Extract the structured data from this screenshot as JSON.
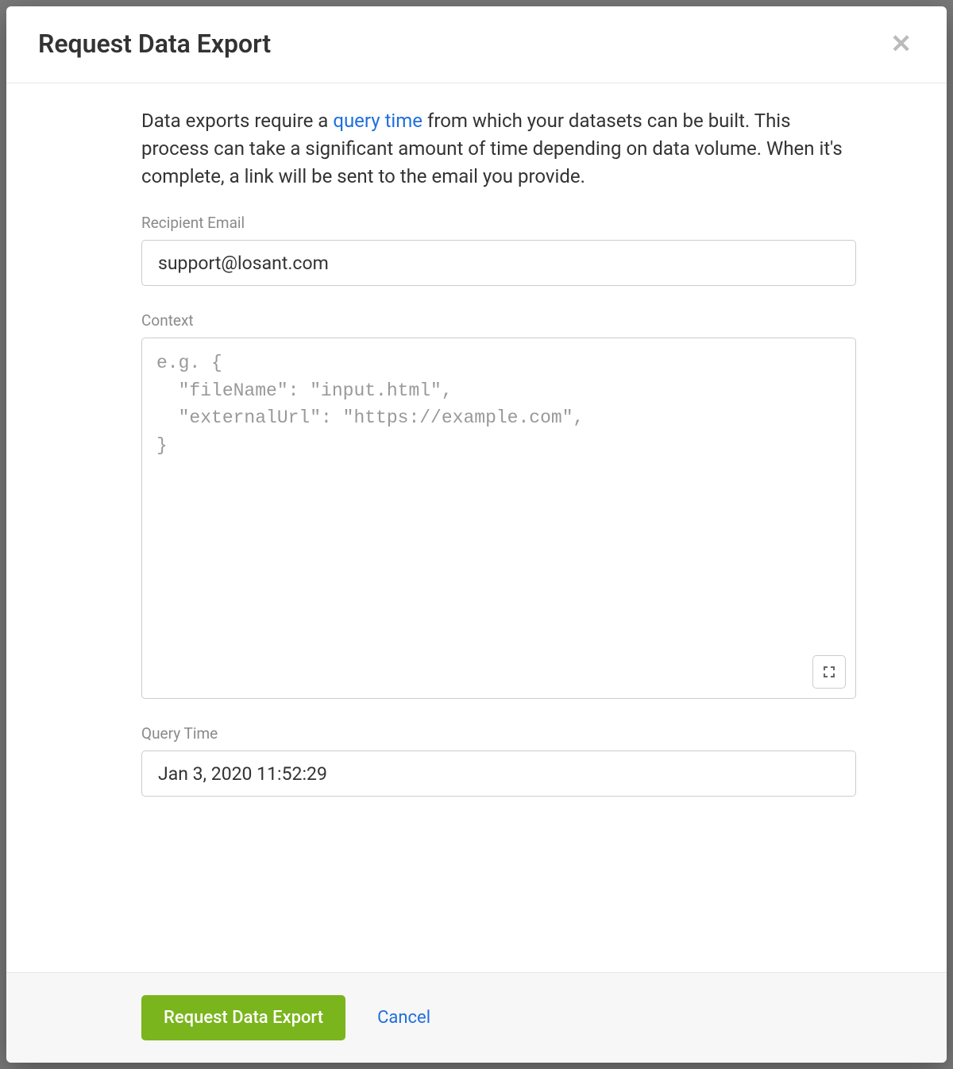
{
  "modal": {
    "title": "Request Data Export",
    "description_pre": "Data exports require a ",
    "description_link": "query time",
    "description_post": " from which your datasets can be built. This process can take a significant amount of time depending on data volume. When it's complete, a link will be sent to the email you provide."
  },
  "form": {
    "email_label": "Recipient Email",
    "email_value": "support@losant.com",
    "context_label": "Context",
    "context_placeholder": "e.g. {\n  \"fileName\": \"input.html\",\n  \"externalUrl\": \"https://example.com\",\n}",
    "query_time_label": "Query Time",
    "query_time_value": "Jan 3, 2020 11:52:29"
  },
  "footer": {
    "submit_label": "Request Data Export",
    "cancel_label": "Cancel"
  }
}
